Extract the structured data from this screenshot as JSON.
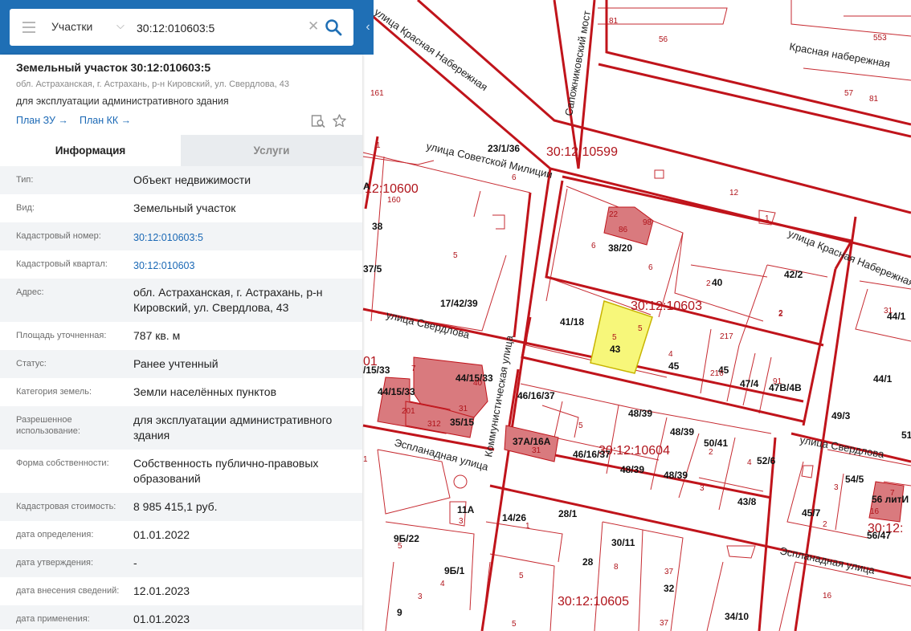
{
  "search": {
    "category": "Участки",
    "query": "30:12:010603:5"
  },
  "parcel": {
    "title": "Земельный участок 30:12:010603:5",
    "address": "обл. Астраханская, г. Астрахань, р-н Кировский, ул. Свердлова, 43",
    "use": "для эксплуатации административного здания",
    "link_zu": "План ЗУ →",
    "link_kk": "План КК →"
  },
  "tabs": {
    "info": "Информация",
    "services": "Услуги"
  },
  "details": [
    {
      "label": "Тип:",
      "value": "Объект недвижимости"
    },
    {
      "label": "Вид:",
      "value": "Земельный участок"
    },
    {
      "label": "Кадастровый номер:",
      "value": "30:12:010603:5"
    },
    {
      "label": "Кадастровый квартал:",
      "value": "30:12:010603"
    },
    {
      "label": "Адрес:",
      "value": "обл. Астраханская, г. Астрахань, р-н Кировский, ул. Свердлова, 43"
    },
    {
      "label": "Площадь уточненная:",
      "value": "787 кв. м"
    },
    {
      "label": "Статус:",
      "value": "Ранее учтенный"
    },
    {
      "label": "Категория земель:",
      "value": "Земли населённых пунктов"
    },
    {
      "label": "Разрешенное использование:",
      "value": "для эксплуатации административного здания"
    },
    {
      "label": "Форма собственности:",
      "value": "Собственность публично-правовых образований"
    },
    {
      "label": "Кадастровая стоимость:",
      "value": "8 985 415,1 руб."
    },
    {
      "label": "дата определения:",
      "value": "01.01.2022"
    },
    {
      "label": "дата утверждения:",
      "value": "-"
    },
    {
      "label": "дата внесения сведений:",
      "value": "12.01.2023"
    },
    {
      "label": "дата применения:",
      "value": "01.01.2023"
    }
  ],
  "map": {
    "colors": {
      "boundary": "#c0141b",
      "building": "#d97a7e",
      "selected": "#f7f77a",
      "label": "#b0141b",
      "number": "#111111"
    },
    "streets": [
      "улица Красная Набережная",
      "Сапожниковский мост",
      "Красная набережная",
      "улица Советской Милиции",
      "улица Красная Набережная",
      "улица Свердлова",
      "Коммунистическая улица",
      "Эспланадная улица",
      "улица Свердлова",
      "Эспланадная улица"
    ],
    "quarters": [
      "30:12:10599",
      "12:10600",
      "30:12:10603",
      "30:12:10604",
      "30:12:10605",
      "30:12:",
      "01"
    ],
    "house_numbers": [
      "23/1/36",
      "38/20",
      "42/2",
      "38",
      "37/5",
      "17/42/39",
      "41/18",
      "43",
      "40",
      "45",
      "45",
      "47/4",
      "47В/4В",
      "44/1",
      "44/1",
      "44/15/33",
      "44/15/33",
      "/15/33",
      "35/15",
      "46/16/37",
      "48/39",
      "48/39",
      "37А/16А",
      "46/16/37",
      "50/41",
      "52/6",
      "48/39",
      "48/39",
      "49/3",
      "54/5",
      "56 литИ",
      "45/7",
      "56/47",
      "43/8",
      "11А",
      "14/26",
      "28/1",
      "9Б/22",
      "9Б/1",
      "30/11",
      "28",
      "32",
      "9",
      "34/10",
      "А",
      "51"
    ],
    "plot_numbers": [
      "81",
      "56",
      "553",
      "57",
      "81",
      "161",
      "1",
      "12",
      "160",
      "5",
      "6",
      "6",
      "2",
      "5",
      "5",
      "4",
      "2",
      "217",
      "216",
      "91",
      "31",
      "7",
      "40",
      "201",
      "31",
      "312",
      "5",
      "31",
      "2",
      "4",
      "3",
      "3",
      "7",
      "16",
      "2",
      "1",
      "5",
      "4",
      "3",
      "8",
      "37",
      "5",
      "37",
      "16",
      "1",
      "3",
      "6",
      "5",
      "2",
      "1",
      "22",
      "86",
      "98"
    ]
  }
}
